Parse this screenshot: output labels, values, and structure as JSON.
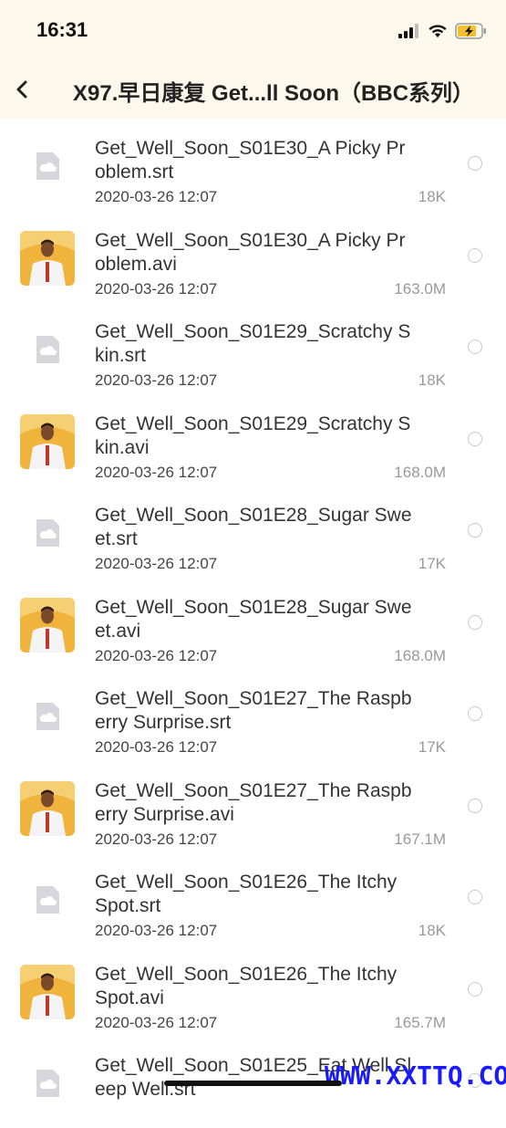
{
  "status": {
    "time": "16:31"
  },
  "nav": {
    "title": "X97.早日康复 Get...ll Soon（BBC系列）"
  },
  "files": [
    {
      "name": "Get_Well_Soon_S01E30_A Picky Problem.srt",
      "date": "2020-03-26 12:07",
      "size": "18K",
      "kind": "srt"
    },
    {
      "name": "Get_Well_Soon_S01E30_A Picky Problem.avi",
      "date": "2020-03-26 12:07",
      "size": "163.0M",
      "kind": "video"
    },
    {
      "name": "Get_Well_Soon_S01E29_Scratchy Skin.srt",
      "date": "2020-03-26 12:07",
      "size": "18K",
      "kind": "srt"
    },
    {
      "name": "Get_Well_Soon_S01E29_Scratchy Skin.avi",
      "date": "2020-03-26 12:07",
      "size": "168.0M",
      "kind": "video"
    },
    {
      "name": "Get_Well_Soon_S01E28_Sugar Sweet.srt",
      "date": "2020-03-26 12:07",
      "size": "17K",
      "kind": "srt"
    },
    {
      "name": "Get_Well_Soon_S01E28_Sugar Sweet.avi",
      "date": "2020-03-26 12:07",
      "size": "168.0M",
      "kind": "video"
    },
    {
      "name": "Get_Well_Soon_S01E27_The Raspberry Surprise.srt",
      "date": "2020-03-26 12:07",
      "size": "17K",
      "kind": "srt"
    },
    {
      "name": "Get_Well_Soon_S01E27_The Raspberry Surprise.avi",
      "date": "2020-03-26 12:07",
      "size": "167.1M",
      "kind": "video"
    },
    {
      "name": "Get_Well_Soon_S01E26_The Itchy Spot.srt",
      "date": "2020-03-26 12:07",
      "size": "18K",
      "kind": "srt"
    },
    {
      "name": "Get_Well_Soon_S01E26_The Itchy Spot.avi",
      "date": "2020-03-26 12:07",
      "size": "165.7M",
      "kind": "video"
    },
    {
      "name": "Get_Well_Soon_S01E25_Eat Well Sleep Well.srt",
      "date": "",
      "size": "",
      "kind": "srt"
    }
  ],
  "watermark": "WWW.XXTTQ.COM",
  "colors": {
    "header_bg": "#fcf8ec",
    "video_thumb_bg": "#f0b43c",
    "file_icon": "#d6d6dc"
  }
}
